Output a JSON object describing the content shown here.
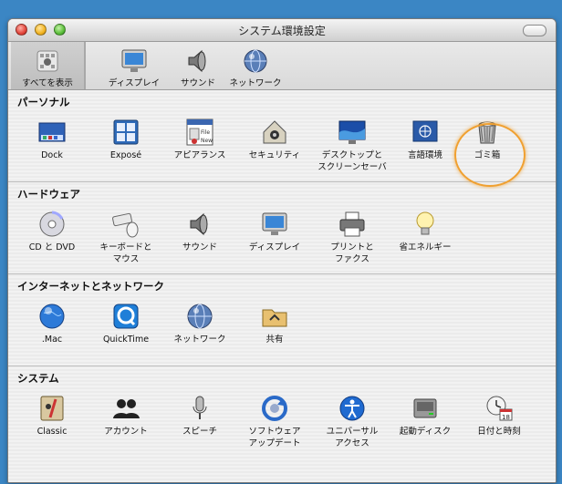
{
  "window": {
    "title": "システム環境設定"
  },
  "toolbar": {
    "show_all": "すべてを表示",
    "items": [
      "ディスプレイ",
      "サウンド",
      "ネットワーク"
    ]
  },
  "sections": [
    {
      "title": "パーソナル",
      "items": [
        "Dock",
        "Exposé",
        "アピアランス",
        "セキュリティ",
        "デスクトップと\nスクリーンセーバ",
        "言語環境",
        "ゴミ箱"
      ]
    },
    {
      "title": "ハードウェア",
      "items": [
        "CD と DVD",
        "キーボードと\nマウス",
        "サウンド",
        "ディスプレイ",
        "プリントと\nファクス",
        "省エネルギー"
      ]
    },
    {
      "title": "インターネットとネットワーク",
      "items": [
        ".Mac",
        "QuickTime",
        "ネットワーク",
        "共有"
      ]
    },
    {
      "title": "システム",
      "items": [
        "Classic",
        "アカウント",
        "スピーチ",
        "ソフトウェア\nアップデート",
        "ユニバーサル\nアクセス",
        "起動ディスク",
        "日付と時刻"
      ]
    }
  ],
  "icons": {
    "appearance_badges": [
      "File",
      "New"
    ],
    "calendar_day": "18"
  },
  "colors": {
    "highlight": "#f0a030",
    "desktop": "#3b86c4"
  }
}
